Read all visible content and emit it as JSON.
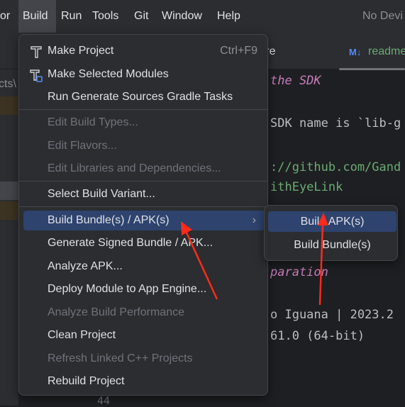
{
  "menubar": {
    "items": [
      "or",
      "Build",
      "Run",
      "Tools",
      "Git",
      "Window",
      "Help"
    ],
    "status": "No Devi"
  },
  "tabs": {
    "gitignore": "itignore",
    "readme_icon": "M↓",
    "readme": "readme"
  },
  "left_panel": {
    "path_fragment": "cts\\"
  },
  "editor": {
    "lines": [
      "the SDK",
      "SDK name is `lib-g",
      "://github.com/Gand",
      "ithEyeLink",
      "paration",
      "o Iguana | 2023.2",
      "61.0 (64-bit)"
    ],
    "gutter_line": "44"
  },
  "build_menu": {
    "items": [
      {
        "label": "Make Project",
        "shortcut": "Ctrl+F9",
        "icon": "hammer-icon"
      },
      {
        "label": "Make Selected Modules",
        "icon": "hammer-module-icon"
      },
      {
        "label": "Run Generate Sources Gradle Tasks"
      },
      {
        "label": "Edit Build Types...",
        "disabled": true
      },
      {
        "label": "Edit Flavors...",
        "disabled": true
      },
      {
        "label": "Edit Libraries and Dependencies...",
        "disabled": true
      },
      {
        "label": "Select Build Variant..."
      },
      {
        "label": "Build Bundle(s) / APK(s)",
        "highlighted": true,
        "submenu": true
      },
      {
        "label": "Generate Signed Bundle / APK..."
      },
      {
        "label": "Analyze APK..."
      },
      {
        "label": "Deploy Module to App Engine..."
      },
      {
        "label": "Analyze Build Performance",
        "disabled": true
      },
      {
        "label": "Clean Project"
      },
      {
        "label": "Refresh Linked C++ Projects",
        "disabled": true
      },
      {
        "label": "Rebuild Project"
      }
    ],
    "chevron": "›"
  },
  "submenu": {
    "items": [
      "Build APK(s)",
      "Build Bundle(s)"
    ]
  },
  "colors": {
    "accent": "#2e436e",
    "annotation": "#ff2a1a"
  }
}
